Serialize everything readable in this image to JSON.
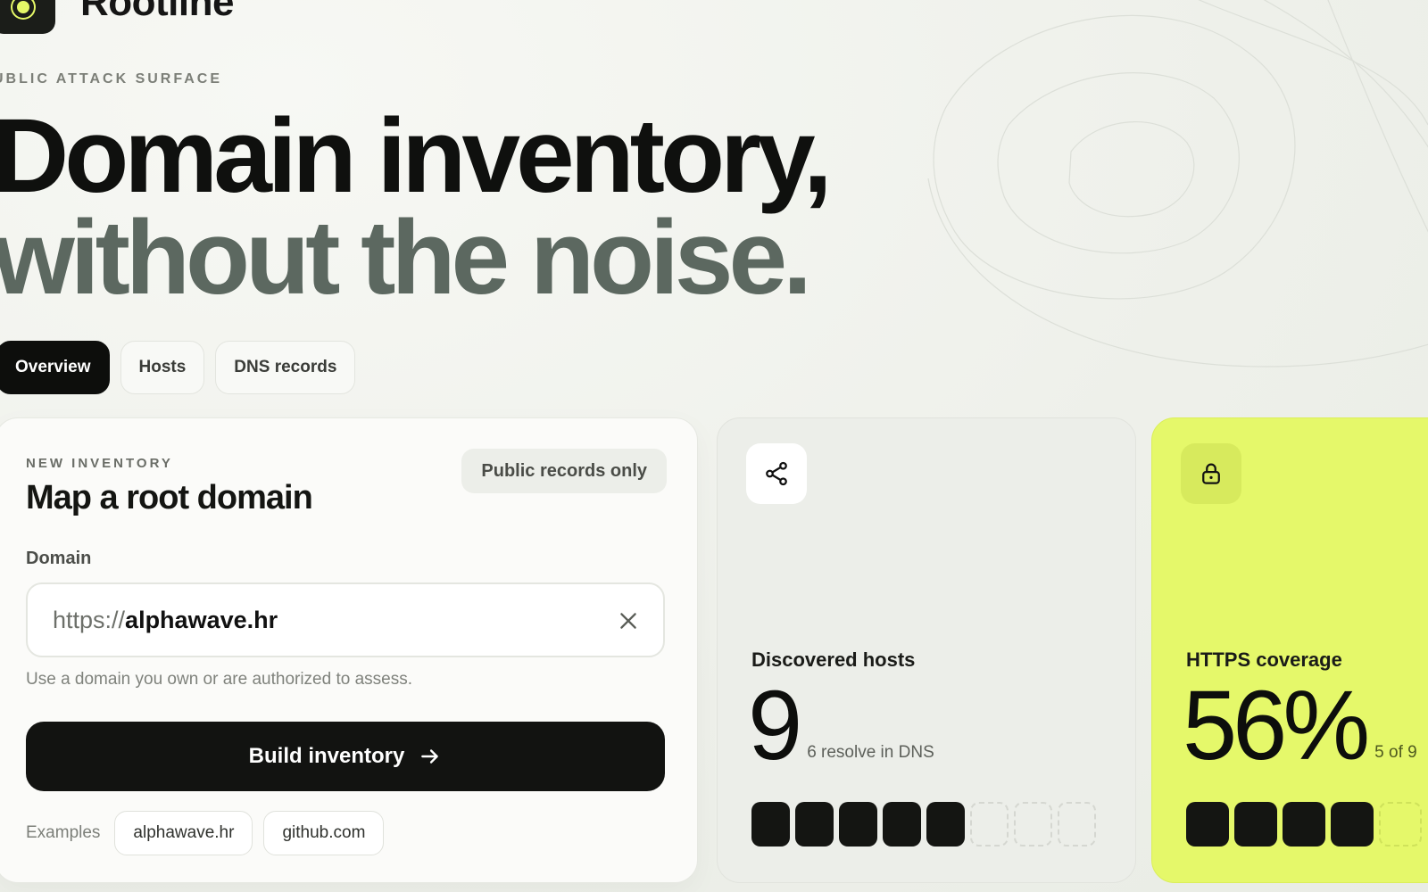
{
  "brand": {
    "name": "Rootline"
  },
  "hero": {
    "eyebrow": "UBLIC ATTACK SURFACE",
    "title_line1": "Domain inventory,",
    "title_line2": "without the noise."
  },
  "tabs": [
    {
      "label": "Overview",
      "active": true
    },
    {
      "label": "Hosts",
      "active": false
    },
    {
      "label": "DNS records",
      "active": false
    }
  ],
  "form": {
    "eyebrow": "NEW INVENTORY",
    "title": "Map a root domain",
    "badge": "Public records only",
    "field_label": "Domain",
    "input_prefix": "https://",
    "input_value": "alphawave.hr",
    "hint": "Use a domain you own or are authorized to assess.",
    "submit_label": "Build inventory",
    "examples_label": "Examples",
    "examples": [
      "alphawave.hr",
      "github.com"
    ]
  },
  "stats": {
    "hosts": {
      "icon": "share-icon",
      "label": "Discovered hosts",
      "value": "9",
      "sub": "6 resolve in DNS",
      "filled": 5,
      "total": 8
    },
    "https": {
      "icon": "lock-icon",
      "label": "HTTPS coverage",
      "value": "56%",
      "sub": "5 of 9",
      "filled": 4,
      "total": 5
    }
  },
  "colors": {
    "accent": "#e5f86a",
    "dark": "#121311",
    "background": "#eff1ec"
  }
}
